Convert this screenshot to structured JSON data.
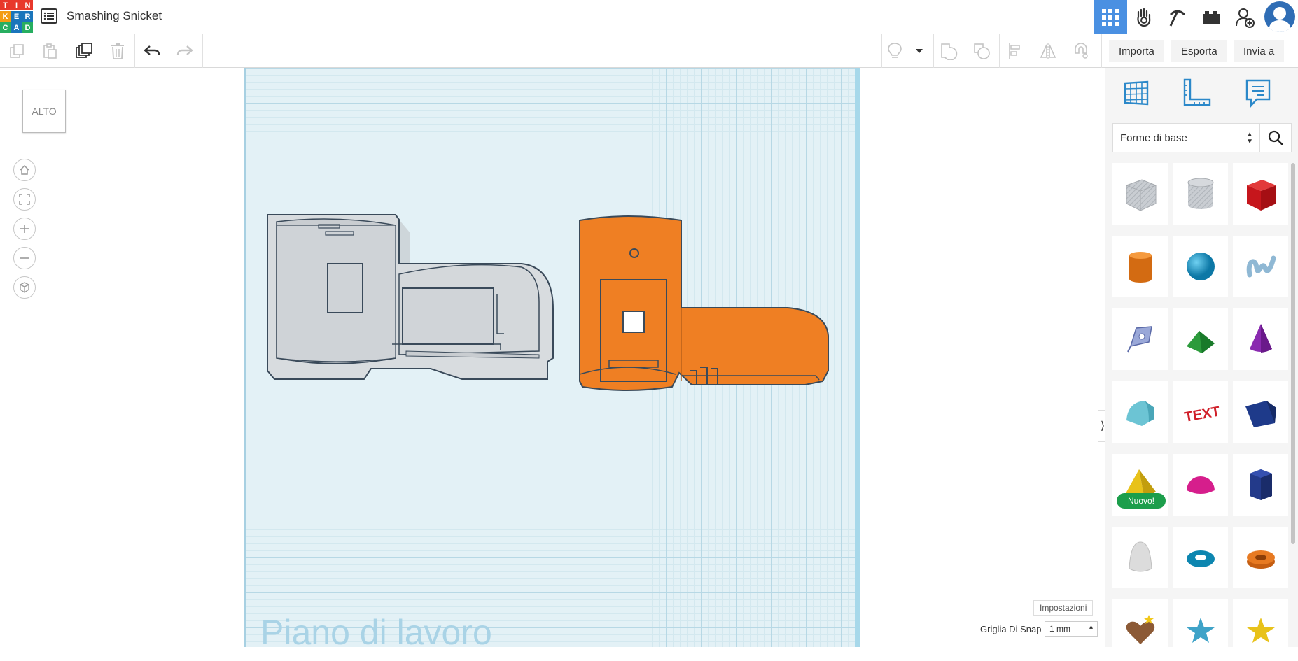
{
  "app": {
    "logo_letters": [
      "T",
      "I",
      "N",
      "K",
      "E",
      "R",
      "C",
      "A",
      "D"
    ],
    "logo_colors": [
      "#e8382b",
      "#e8382b",
      "#e8382b",
      "#f39c12",
      "#1a75bb",
      "#1a75bb",
      "#27ae60",
      "#1a75bb",
      "#27ae60"
    ],
    "title": "Smashing Snicket",
    "accent": "#4a90e2"
  },
  "nav": {
    "items": [
      "grid-view-icon",
      "tinker-hand-icon",
      "pickaxe-icon",
      "bricks-icon",
      "add-user-icon",
      "user-avatar"
    ]
  },
  "toolbar": {
    "import_label": "Importa",
    "export_label": "Esporta",
    "send_label": "Invia a"
  },
  "viewport": {
    "viewcube_label": "ALTO",
    "workplane_label": "Piano di lavoro",
    "settings_label": "Impostazioni",
    "snap_label": "Griglia Di Snap",
    "snap_value": "1 mm",
    "workplane_color": "#e3f1f6"
  },
  "panel": {
    "category": "Forme di base",
    "new_badge": "Nuovo!",
    "shapes": [
      "hole-box",
      "hole-cylinder",
      "box",
      "cylinder",
      "sphere",
      "scribble",
      "shape-generator",
      "roof",
      "cone",
      "round-roof",
      "text",
      "wedge",
      "pyramid",
      "half-sphere",
      "polygon",
      "paraboloid",
      "torus",
      "tube",
      "heart",
      "star",
      "star-yellow"
    ]
  }
}
